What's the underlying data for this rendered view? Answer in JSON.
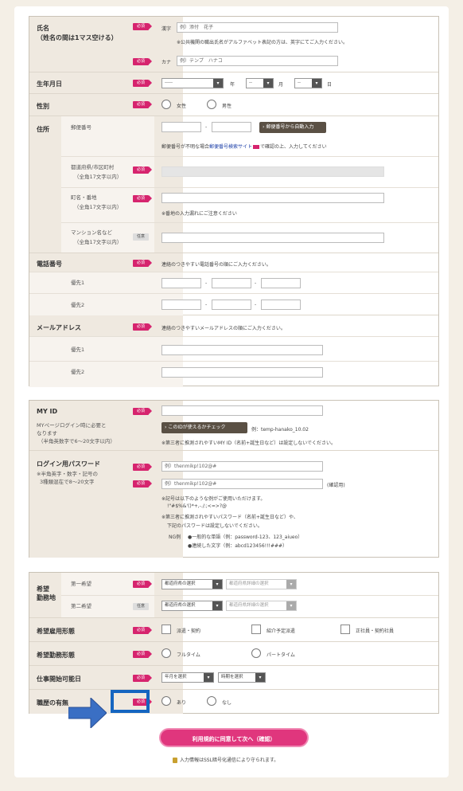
{
  "personal": {
    "name": {
      "label": "氏名",
      "note": "（姓名の間は1マス空ける）",
      "kanji_prefix": "漢字",
      "kanji_placeholder": "例）添付　花子",
      "kanji_note": "※公共機関の職出氏名がアルファベット表記の方は、英字にてご入力ください。",
      "kana_prefix": "カナ",
      "kana_placeholder": "例）テンプ　ハナコ"
    },
    "birth": {
      "label": "生年月日",
      "year_value": "-----",
      "year_unit": "年",
      "month_value": "--",
      "month_unit": "月",
      "day_value": "--",
      "day_unit": "日"
    },
    "gender": {
      "label": "性別",
      "options": [
        "女性",
        "男性"
      ]
    },
    "address": {
      "label": "住所",
      "zip_label": "郵便番号",
      "zip_button": "郵便番号から自動入力",
      "zip_note_before": "郵便番号が不明な場合",
      "zip_note_link": "郵便番号検索サイト",
      "zip_note_after": "で確認の上、入力してください",
      "pref_label": "都道府県/市区町村",
      "pref_note": "（全角17文字以内）",
      "town_label": "町名・番地",
      "town_note": "（全角17文字以内）",
      "town_hint": "※番地の入力漏れにご注意ください",
      "bldg_label": "マンション名など",
      "bldg_note": "（全角17文字以内）"
    },
    "phone": {
      "label": "電話番号",
      "hint": "連絡のつきやすい電話番号の順にご入力ください。",
      "sub1": "優先1",
      "sub2": "優先2"
    },
    "email": {
      "label": "メールアドレス",
      "hint": "連絡のつきやすいメールアドレスの順にご入力ください。",
      "sub1": "優先1",
      "sub2": "優先2"
    }
  },
  "account": {
    "myid": {
      "label": "MY ID",
      "note1": "MYページログイン時に必要と",
      "note2": "なります",
      "note3": "（半角英数字で6〜20文字以内）",
      "check_button": "このIDが使えるかチェック",
      "example": "例：temp-hanako_10.02",
      "warning": "※第三者に推測されやすいMY ID（名前+誕生日など）は設定しないでください。"
    },
    "password": {
      "label": "ログイン用パスワード",
      "note1": "※半角英字・数字・記号の",
      "note2": "3種類混在で8〜20文字",
      "placeholder1": "例）thenmikp!102@#",
      "placeholder2": "例）thenmikp!102@#",
      "confirm_label": "(確認用)",
      "rule1": "※記号は以下のような例がご使用いただけます。",
      "rule2": "!\"#$%&'()*+,-./:;<=>?@",
      "rule3": "※第三者に推測されやすいパスワード（名前+誕生日など）や、",
      "rule4": "下記のパスワードは設定しないでください。",
      "ng_label": "NG例",
      "ng1": "●一般的な単語（例：password-123、123_aiueo）",
      "ng2": "●連続した文字（例：abcd123456!!!###）"
    }
  },
  "preferences": {
    "area": {
      "label1": "希望",
      "label2": "勤務地",
      "first": "第一希望",
      "second": "第二希望",
      "pref_select": "都道府県の選択",
      "detail_select": "都道府県詳細の選択"
    },
    "employment": {
      "label": "希望雇用形態",
      "options": [
        "派遣・契約",
        "紹介予定派遣",
        "正社員・契約社員"
      ]
    },
    "worktype": {
      "label": "希望勤務形態",
      "options": [
        "フルタイム",
        "パートタイム"
      ]
    },
    "start": {
      "label": "仕事開始可能日",
      "month_select": "年月を選択",
      "period_select": "時期を選択"
    },
    "experience": {
      "label": "職歴の有無",
      "options": [
        "あり",
        "なし"
      ]
    }
  },
  "badges": {
    "required": "必須",
    "optional": "任意"
  },
  "submit_label": "利用規約に同意して次へ（確認）",
  "footer_note": "入力情報はSSL暗号化通信により守られます。",
  "colors": {
    "accent": "#d6246e",
    "highlight": "#1565c0",
    "label_bg": "#efe9e0",
    "page_bg": "#f4efe6"
  }
}
